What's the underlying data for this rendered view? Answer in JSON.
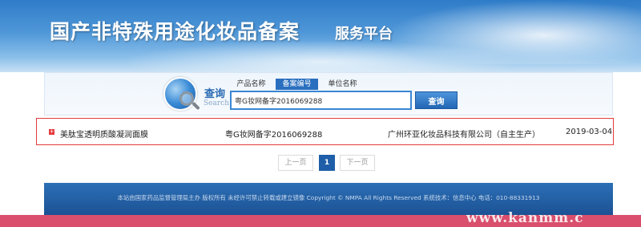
{
  "banner": {
    "title": "国产非特殊用途化妆品备案",
    "subtitle": "服务平台"
  },
  "search": {
    "label": "查询",
    "label_en": "Search",
    "tabs": [
      {
        "label": "产品名称",
        "active": false
      },
      {
        "label": "备案编号",
        "active": true
      },
      {
        "label": "单位名称",
        "active": false
      }
    ],
    "input_value": "粤G妆网备字2016069288",
    "button_label": "查询"
  },
  "result": {
    "bullet": "+",
    "product_name": "美肽宝透明质酸凝润面膜",
    "record_number": "粤G妆网备字2016069288",
    "company": "广州环亚化妆品科技有限公司（自主生产）",
    "date": "2019-03-04"
  },
  "pagination": {
    "prev_label": "上一页",
    "current_page": "1",
    "next_label": "下一页"
  },
  "footer": {
    "text": "本站由国家药品监督管理局主办 版权所有 未经许可禁止转载或建立镜像 Copyright © NMPA All Rights Reserved 系统技术：信息中心 电话：010-88331913"
  },
  "watermark": {
    "text": "www.kanmm.c"
  },
  "colors": {
    "primary_blue": "#2a6fbf",
    "result_border": "#e23b3b",
    "footer_blue": "#1c5294",
    "pink_strip": "#d94f6d"
  }
}
